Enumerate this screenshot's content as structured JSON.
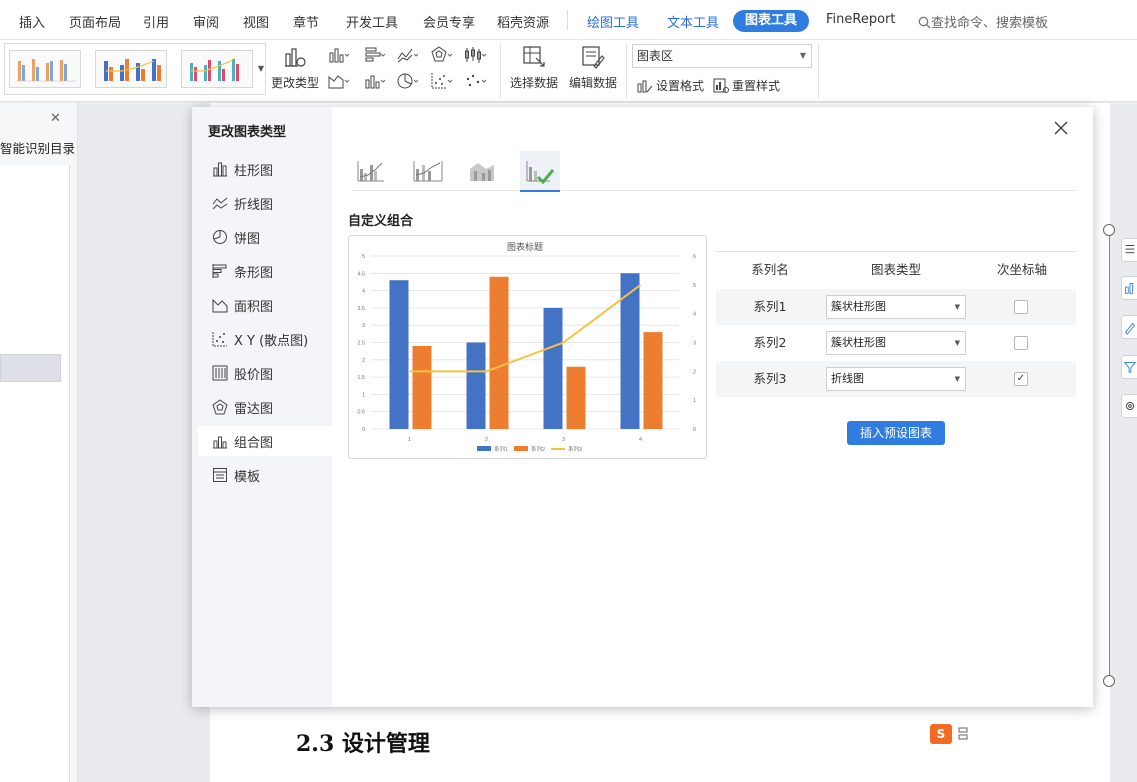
{
  "menu": {
    "items": [
      "插入",
      "页面布局",
      "引用",
      "审阅",
      "视图",
      "章节",
      "开发工具",
      "会员专享",
      "稻壳资源"
    ],
    "context_tabs": [
      "绘图工具",
      "文本工具"
    ],
    "active_tab": "图表工具",
    "fine_report": "FineReport",
    "search": "查找命令、搜索模板"
  },
  "ribbon": {
    "change_type": "更改类型",
    "select_data": "选择数据",
    "edit_data": "编辑数据",
    "area_select": "图表区",
    "set_format": "设置格式",
    "reset_style": "重置样式"
  },
  "left_panel": {
    "title": "智能识别目录"
  },
  "document": {
    "heading": "2.3 设计管理",
    "ime_logo": "S"
  },
  "dialog": {
    "title": "更改图表类型",
    "types": [
      {
        "label": "柱形图",
        "icon": "column-chart-icon"
      },
      {
        "label": "折线图",
        "icon": "line-chart-icon"
      },
      {
        "label": "饼图",
        "icon": "pie-chart-icon"
      },
      {
        "label": "条形图",
        "icon": "bar-chart-icon"
      },
      {
        "label": "面积图",
        "icon": "area-chart-icon"
      },
      {
        "label": "X Y (散点图)",
        "icon": "scatter-chart-icon"
      },
      {
        "label": "股价图",
        "icon": "stock-chart-icon"
      },
      {
        "label": "雷达图",
        "icon": "radar-chart-icon"
      },
      {
        "label": "组合图",
        "icon": "combo-chart-icon"
      },
      {
        "label": "模板",
        "icon": "template-icon"
      }
    ],
    "active_type": "组合图",
    "section_title": "自定义组合",
    "table": {
      "headers": [
        "系列名",
        "图表类型",
        "次坐标轴"
      ],
      "rows": [
        {
          "name": "系列1",
          "type": "簇状柱形图",
          "secondary": false
        },
        {
          "name": "系列2",
          "type": "簇状柱形图",
          "secondary": false
        },
        {
          "name": "系列3",
          "type": "折线图",
          "secondary": true
        }
      ]
    },
    "insert_button": "插入预设图表"
  },
  "colors": {
    "accent": "#2f7de1",
    "series1": "#4472c4",
    "series2": "#ed7d31",
    "series3": "#f5c242"
  },
  "chart_data": {
    "type": "bar",
    "title": "图表标题",
    "categories": [
      "1",
      "2",
      "3",
      "4"
    ],
    "y_ticks": [
      "0",
      "0.5",
      "1",
      "1.5",
      "2",
      "2.5",
      "3",
      "3.5",
      "4",
      "4.5",
      "5"
    ],
    "y2_ticks": [
      "0",
      "1",
      "2",
      "3",
      "4",
      "5",
      "6"
    ],
    "ylim": [
      0,
      5
    ],
    "y2lim": [
      0,
      6
    ],
    "series": [
      {
        "name": "系列1",
        "type": "bar",
        "values": [
          4.3,
          2.5,
          3.5,
          4.5
        ],
        "color": "#4472c4"
      },
      {
        "name": "系列2",
        "type": "bar",
        "values": [
          2.4,
          4.4,
          1.8,
          2.8
        ],
        "color": "#ed7d31"
      },
      {
        "name": "系列3",
        "type": "line",
        "axis": "secondary",
        "values": [
          2,
          2,
          3,
          5
        ],
        "color": "#f5c242"
      }
    ],
    "legend": "bottom",
    "grid": true
  }
}
